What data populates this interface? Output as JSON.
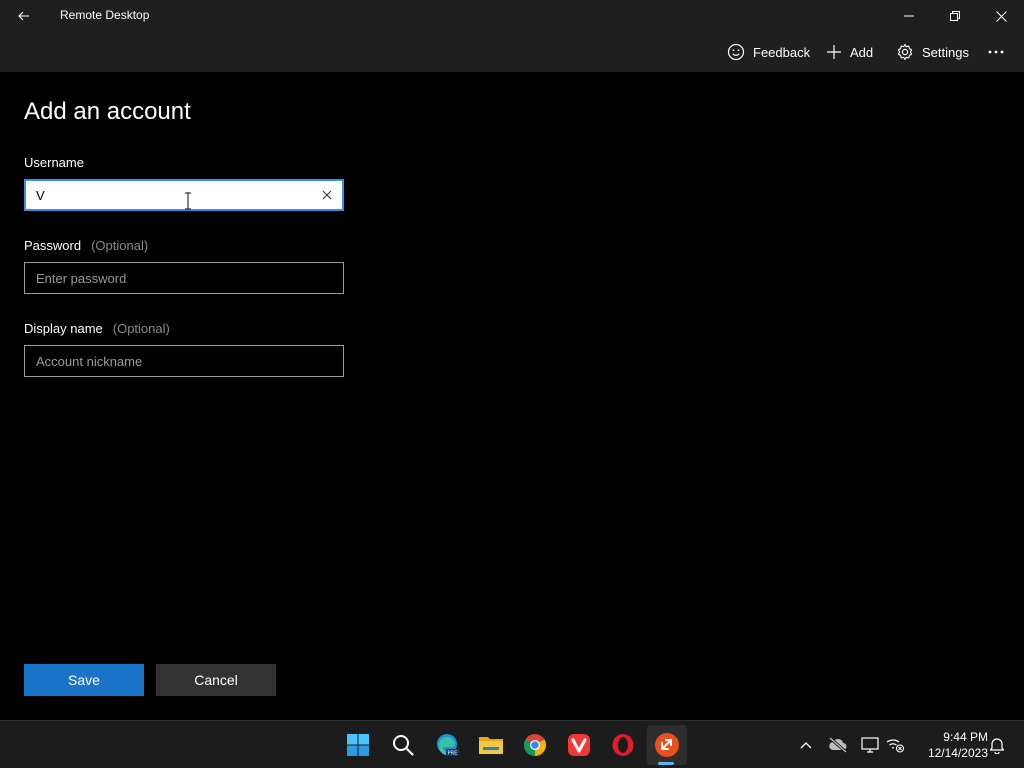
{
  "window": {
    "title": "Remote Desktop"
  },
  "commandbar": {
    "feedback_label": "Feedback",
    "add_label": "Add",
    "settings_label": "Settings"
  },
  "form": {
    "title": "Add an account",
    "username": {
      "label": "Username",
      "value": "V"
    },
    "password": {
      "label": "Password",
      "optional": "(Optional)",
      "placeholder": "Enter password"
    },
    "display_name": {
      "label": "Display name",
      "optional": "(Optional)",
      "placeholder": "Account nickname"
    },
    "save_label": "Save",
    "cancel_label": "Cancel"
  },
  "taskbar": {
    "apps": [
      "windows-start-icon",
      "search-icon",
      "edge-beta-icon",
      "file-explorer-icon",
      "chrome-icon",
      "vivaldi-icon",
      "opera-icon",
      "remote-desktop-icon"
    ],
    "time": "9:44 PM",
    "date": "12/14/2023"
  },
  "colors": {
    "accent": "#1a73c8",
    "focus_border": "#3b8ee6",
    "background": "#000000",
    "chrome": "#1f1f1f"
  }
}
